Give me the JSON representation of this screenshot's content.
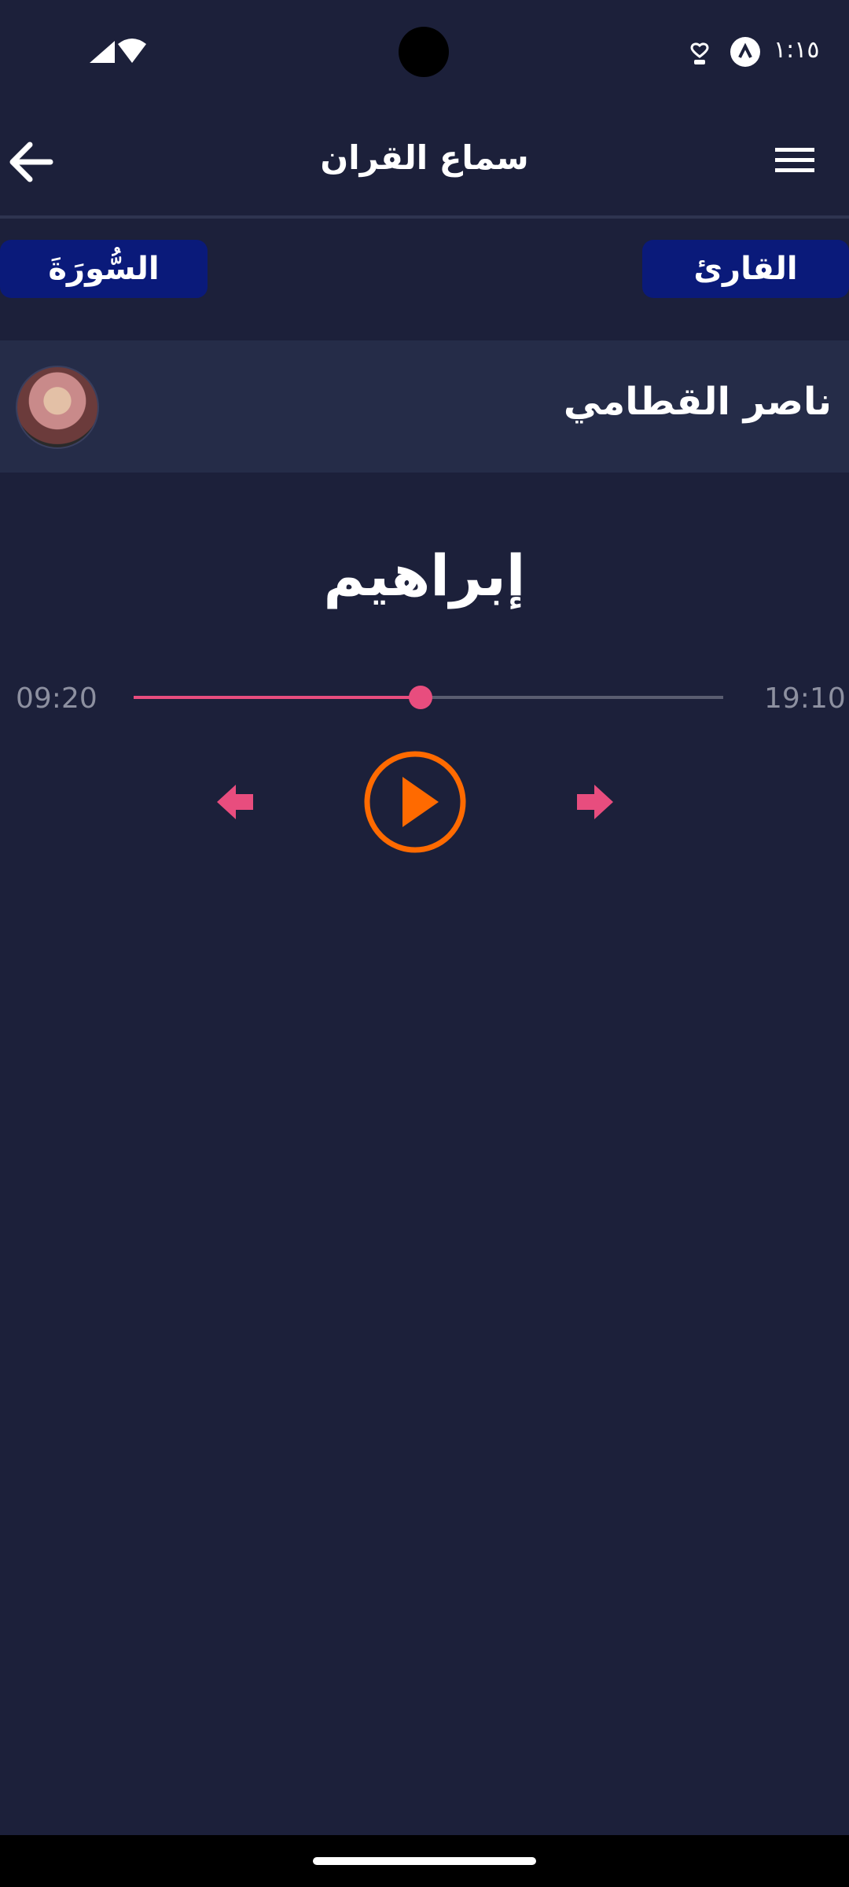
{
  "status_bar": {
    "time": "١:١٥",
    "icons": [
      "signal-icon",
      "wifi-icon",
      "health-icon",
      "account-icon"
    ]
  },
  "app_bar": {
    "title": "سماع القران",
    "back_icon": "arrow-left-icon",
    "menu_icon": "hamburger-menu-icon"
  },
  "selectors": {
    "surah_label": "السُّورَةَ",
    "reciter_label": "القارئ"
  },
  "reciter": {
    "name": "ناصر القطامي"
  },
  "player": {
    "surah_name": "إبراهيم",
    "elapsed": "09:20",
    "duration": "19:10",
    "progress": 0.487
  },
  "colors": {
    "background": "#1c203a",
    "accent_pink": "#e84d7e",
    "accent_orange": "#ff6a00",
    "button_blue": "#0a1a7a",
    "row_bg": "#252c48"
  }
}
